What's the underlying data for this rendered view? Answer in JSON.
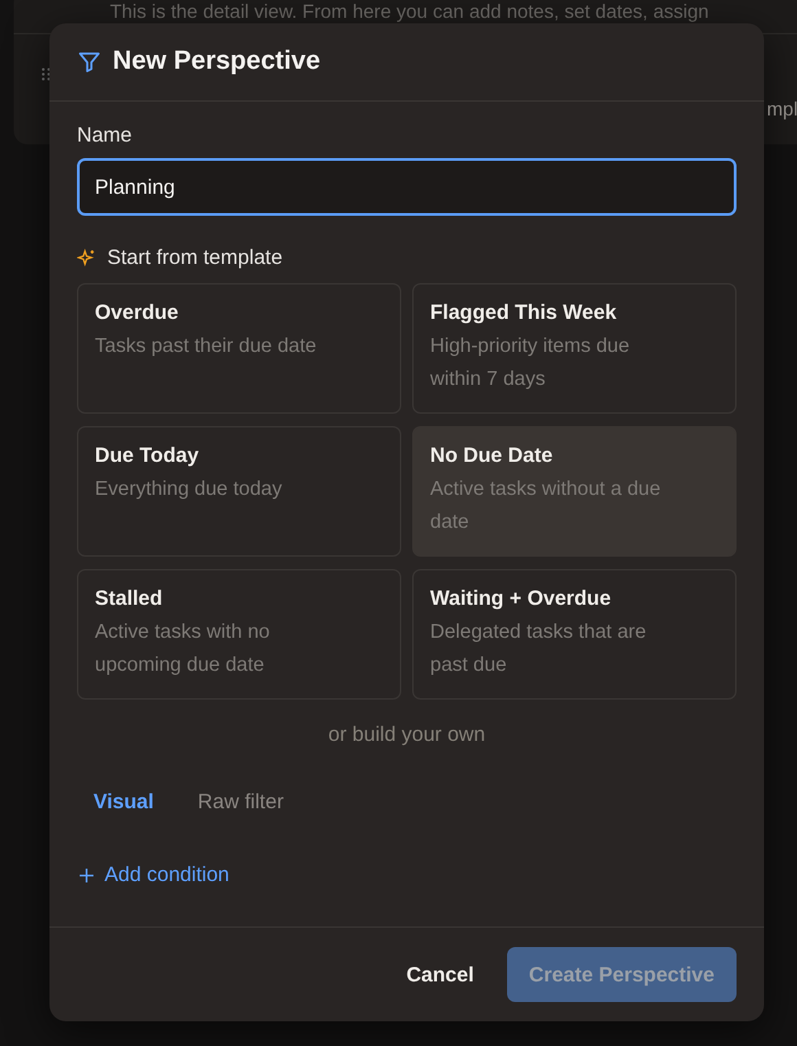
{
  "background": {
    "detail_text": "This is the detail view. From here you can add notes, set dates, assign",
    "side_text": "mpl"
  },
  "dialog": {
    "title": "New Perspective",
    "name_label": "Name",
    "name_value": "Planning",
    "template_label": "Start from template",
    "templates": [
      {
        "title": "Overdue",
        "description": "Tasks past their due date",
        "selected": false
      },
      {
        "title": "Flagged This Week",
        "description": "High-priority items due within 7 days",
        "selected": false
      },
      {
        "title": "Due Today",
        "description": "Everything due today",
        "selected": false
      },
      {
        "title": "No Due Date",
        "description": "Active tasks without a due date",
        "selected": true
      },
      {
        "title": "Stalled",
        "description": "Active tasks with no upcoming due date",
        "selected": false
      },
      {
        "title": "Waiting + Overdue",
        "description": "Delegated tasks that are past due",
        "selected": false
      }
    ],
    "divider_text": "or build your own",
    "tabs": [
      {
        "label": "Visual",
        "selected": true
      },
      {
        "label": "Raw filter",
        "selected": false
      }
    ],
    "add_condition": "Add condition",
    "buttons": [
      {
        "label": "Cancel",
        "kind": "secondary",
        "disabled": false
      },
      {
        "label": "Create Perspective",
        "kind": "primary",
        "disabled": true
      }
    ]
  }
}
